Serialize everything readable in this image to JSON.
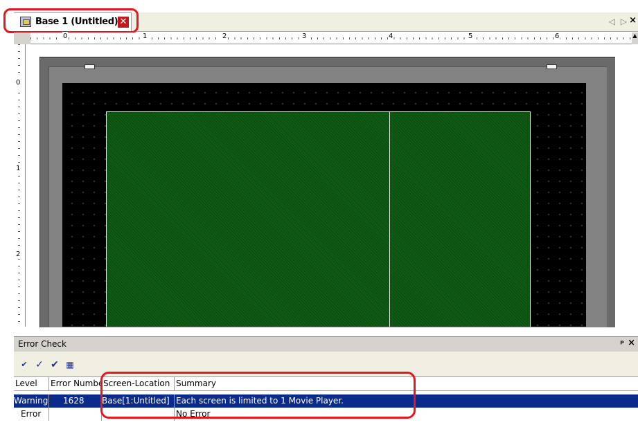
{
  "editor": {
    "tab": {
      "title": "Base 1 (Untitled)",
      "close_glyph": "✕"
    },
    "tab_nav": {
      "arrows": "◁ ▷",
      "close": "×"
    }
  },
  "ruler": {
    "horizontal_labels": [
      "0",
      "1",
      "2",
      "3",
      "4",
      "5",
      "6"
    ],
    "vertical_labels": [
      "0",
      "1",
      "2"
    ]
  },
  "error_check": {
    "title": "Error Check",
    "pin_glyph": "ᵖ",
    "close_glyph": "×",
    "toolbar": [
      "check-all-icon",
      "check-screen-icon",
      "check-selected-icon",
      "list-icon"
    ],
    "columns": [
      "Level",
      "Error Numbe",
      "Screen-Location",
      "Summary"
    ],
    "rows": [
      {
        "level": "Warning",
        "number": "1628",
        "location": "Base[1:Untitled]",
        "summary": "Each screen is limited to 1 Movie Player.",
        "selected": true
      },
      {
        "level": "Error",
        "number": "",
        "location": "",
        "summary": "No Error",
        "selected": false
      }
    ]
  },
  "colors": {
    "highlight": "#e8141e",
    "selection": "#0a2a8c",
    "panel_green": "#0f5a14",
    "screen_black": "#000000"
  }
}
